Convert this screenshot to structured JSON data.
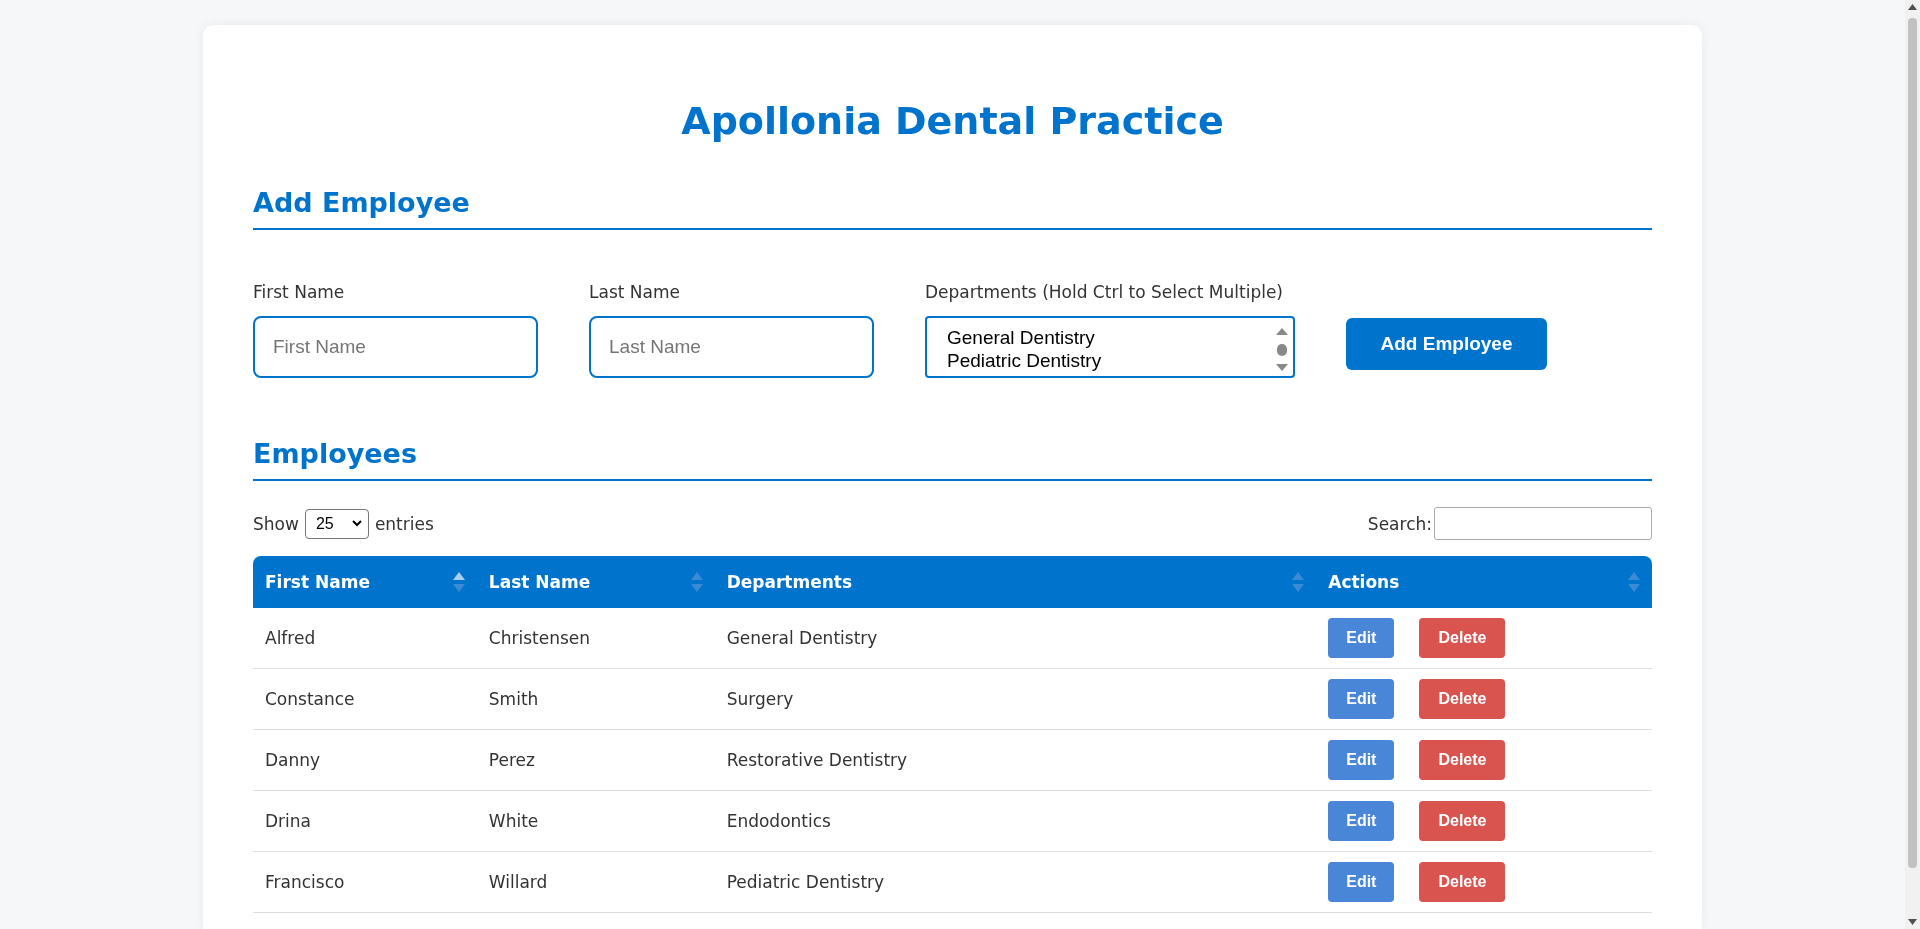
{
  "title": "Apollonia Dental Practice",
  "add_section": {
    "heading": "Add Employee",
    "fields": [
      {
        "kind": "text",
        "label": "First Name",
        "placeholder": "First Name"
      },
      {
        "kind": "text",
        "label": "Last Name",
        "placeholder": "Last Name"
      },
      {
        "kind": "multiselect",
        "label": "Departments (Hold Ctrl to Select Multiple)",
        "options": [
          {
            "label": "General Dentistry",
            "selected": false
          },
          {
            "label": "Pediatric Dentistry",
            "selected": false
          }
        ]
      }
    ],
    "button": "Add Employee"
  },
  "employees": {
    "heading": "Employees",
    "show_label": "Show",
    "page_size": "25",
    "entries_label": "entries",
    "search_label": "Search:",
    "columns": [
      {
        "label": "First Name",
        "sorted": true
      },
      {
        "label": "Last Name",
        "sorted": false
      },
      {
        "label": "Departments",
        "sorted": false
      },
      {
        "label": "Actions",
        "sorted": false
      }
    ],
    "rows": [
      {
        "first": "Alfred",
        "last": "Christensen",
        "department": "General Dentistry",
        "edit": "Edit",
        "delete": "Delete"
      },
      {
        "first": "Constance",
        "last": "Smith",
        "department": "Surgery",
        "edit": "Edit",
        "delete": "Delete"
      },
      {
        "first": "Danny",
        "last": "Perez",
        "department": "Restorative Dentistry",
        "edit": "Edit",
        "delete": "Delete"
      },
      {
        "first": "Drina",
        "last": "White",
        "department": "Endodontics",
        "edit": "Edit",
        "delete": "Delete"
      },
      {
        "first": "Francisco",
        "last": "Willard",
        "department": "Pediatric Dentistry",
        "edit": "Edit",
        "delete": "Delete"
      }
    ]
  }
}
